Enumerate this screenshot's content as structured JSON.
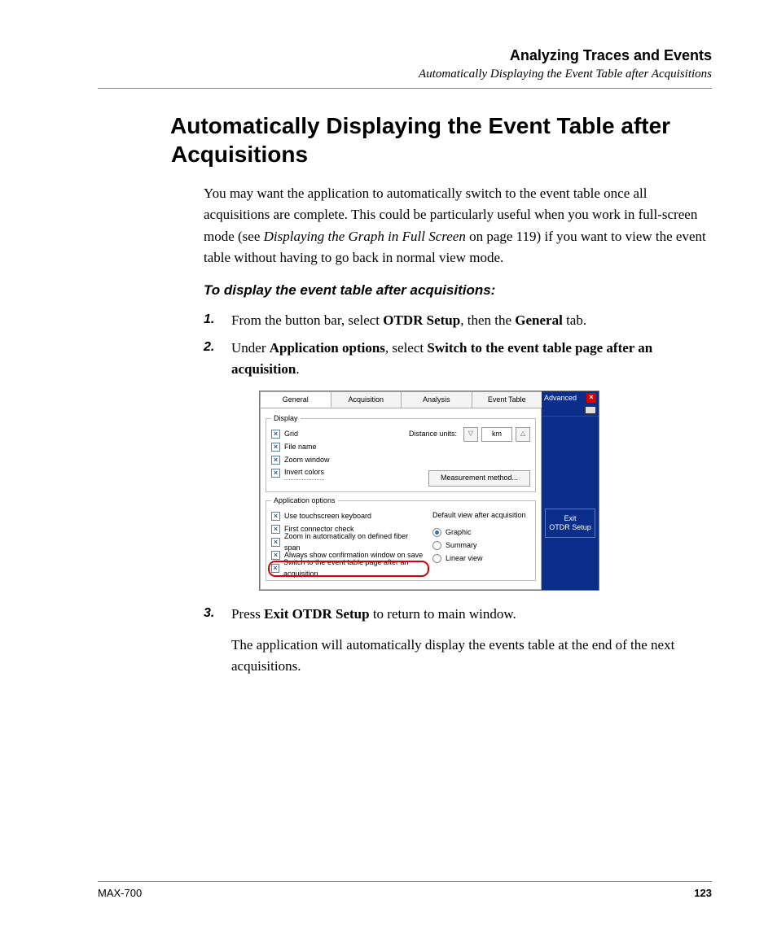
{
  "header": {
    "chapter": "Analyzing Traces and Events",
    "subsection": "Automatically Displaying the Event Table after Acquisitions"
  },
  "title": "Automatically Displaying the Event Table after Acquisitions",
  "intro_pre": "You may want the application to automatically switch to the event table once all acquisitions are complete. This could be particularly useful when you work in full-screen mode (see ",
  "intro_ref": "Displaying the Graph in Full Screen",
  "intro_post": " on page 119) if you want to view the event table without having to go back in normal view mode.",
  "proc_heading": "To display the event table after acquisitions:",
  "steps": {
    "s1_num": "1.",
    "s1_pre": "From the button bar, select ",
    "s1_b1": "OTDR Setup",
    "s1_mid": ", then the ",
    "s1_b2": "General",
    "s1_post": " tab.",
    "s2_num": "2.",
    "s2_pre": "Under ",
    "s2_b1": "Application options",
    "s2_mid": ", select ",
    "s2_b2": "Switch to the event table page after an acquisition",
    "s2_post": ".",
    "s3_num": "3.",
    "s3_pre": "Press ",
    "s3_b1": "Exit OTDR Setup",
    "s3_post": " to return to main window.",
    "s3_result": "The application will automatically display the events table at the end of the next acquisitions."
  },
  "screenshot": {
    "tabs": {
      "general": "General",
      "acquisition": "Acquisition",
      "analysis": "Analysis",
      "event_table": "Event Table"
    },
    "display_group": "Display",
    "grid": "Grid",
    "file_name": "File name",
    "zoom_window": "Zoom window",
    "invert_colors": "Invert colors",
    "distance_units_label": "Distance units:",
    "distance_unit": "km",
    "measurement_btn": "Measurement method...",
    "app_group": "Application options",
    "use_touch": "Use touchscreen keyboard",
    "first_conn": "First connector check",
    "zoom_auto": "Zoom in automatically on defined fiber span",
    "always_conf": "Always show confirmation window on save",
    "switch_event": "Switch to the event table page after an acquisition",
    "default_view": "Default view after acquisition",
    "graphic": "Graphic",
    "summary": "Summary",
    "linear": "Linear view",
    "advanced": "Advanced",
    "exit_line1": "Exit",
    "exit_line2": "OTDR Setup"
  },
  "footer": {
    "product": "MAX-700",
    "page": "123"
  }
}
